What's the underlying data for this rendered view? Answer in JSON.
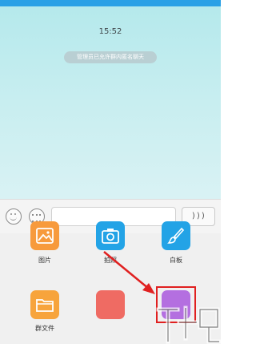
{
  "chat": {
    "timestamp": "15:52",
    "system_notice": "管理员已允许群内匿名聊天"
  },
  "input_bar": {
    "message_placeholder": "",
    "voice_label": ")))"
  },
  "actions": [
    {
      "label": "图片",
      "icon": "image-icon",
      "color": "#f79a3c"
    },
    {
      "label": "拍照",
      "icon": "camera-icon",
      "color": "#23a3e6"
    },
    {
      "label": "白板",
      "icon": "whiteboard-brush-icon",
      "color": "#23a3e6"
    },
    {
      "label": "群文件",
      "icon": "folder-icon",
      "color": "#f7a43c"
    },
    {
      "label": "",
      "icon": "red-action-icon",
      "color": "#ef6b63"
    },
    {
      "label": "",
      "icon": "anonymous-chat-icon",
      "color": "#b46fe0"
    }
  ],
  "annotation": {
    "arrow_color": "#e02020",
    "highlight_color": "#e02020"
  }
}
